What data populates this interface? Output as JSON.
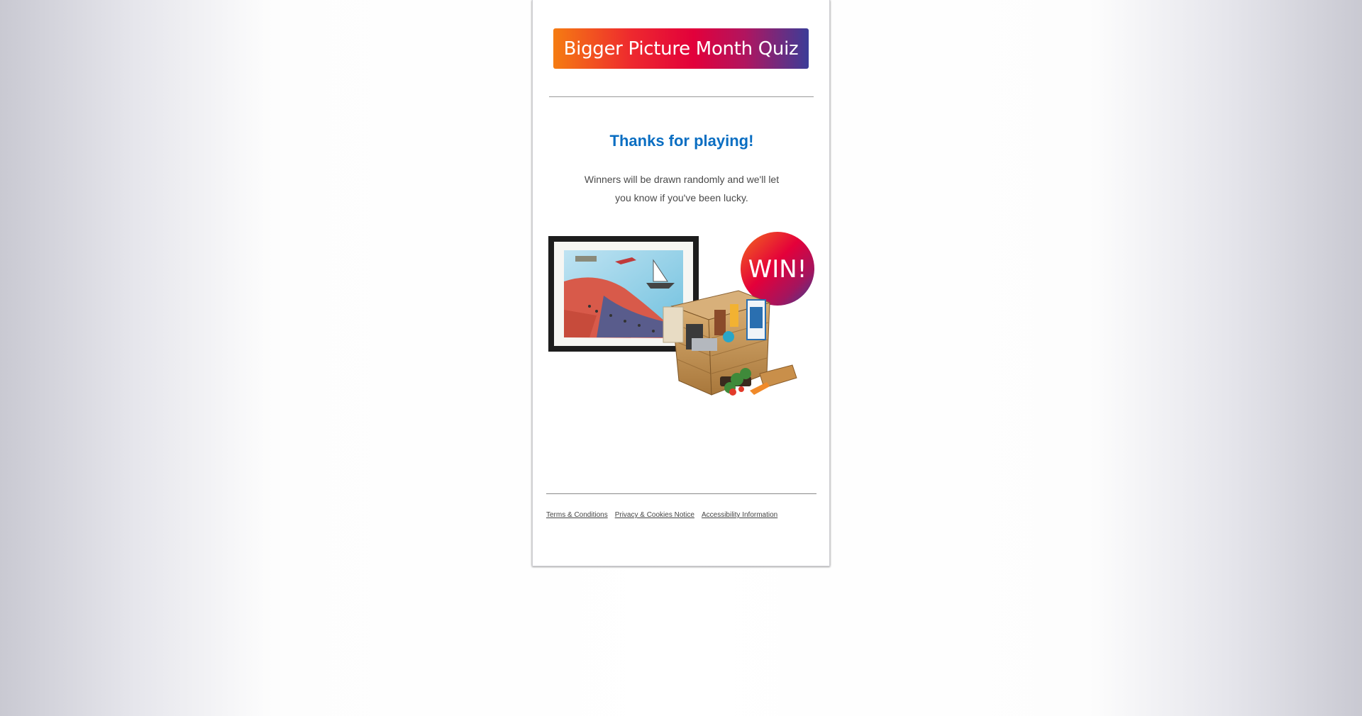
{
  "banner": {
    "title": "Bigger Picture Month Quiz"
  },
  "result": {
    "heading": "Thanks for playing!",
    "message_line1": "Winners will be drawn randomly and we'll let",
    "message_line2": "you know if you've been lucky."
  },
  "prize": {
    "badge": "WIN!"
  },
  "footer": {
    "links": [
      "Terms & Conditions",
      "Privacy & Cookies Notice",
      "Accessibility Information"
    ]
  },
  "colors": {
    "heading": "#0a6ec2",
    "banner_start": "#f57c12",
    "banner_mid": "#e2003b",
    "banner_end": "#3b3d98"
  }
}
